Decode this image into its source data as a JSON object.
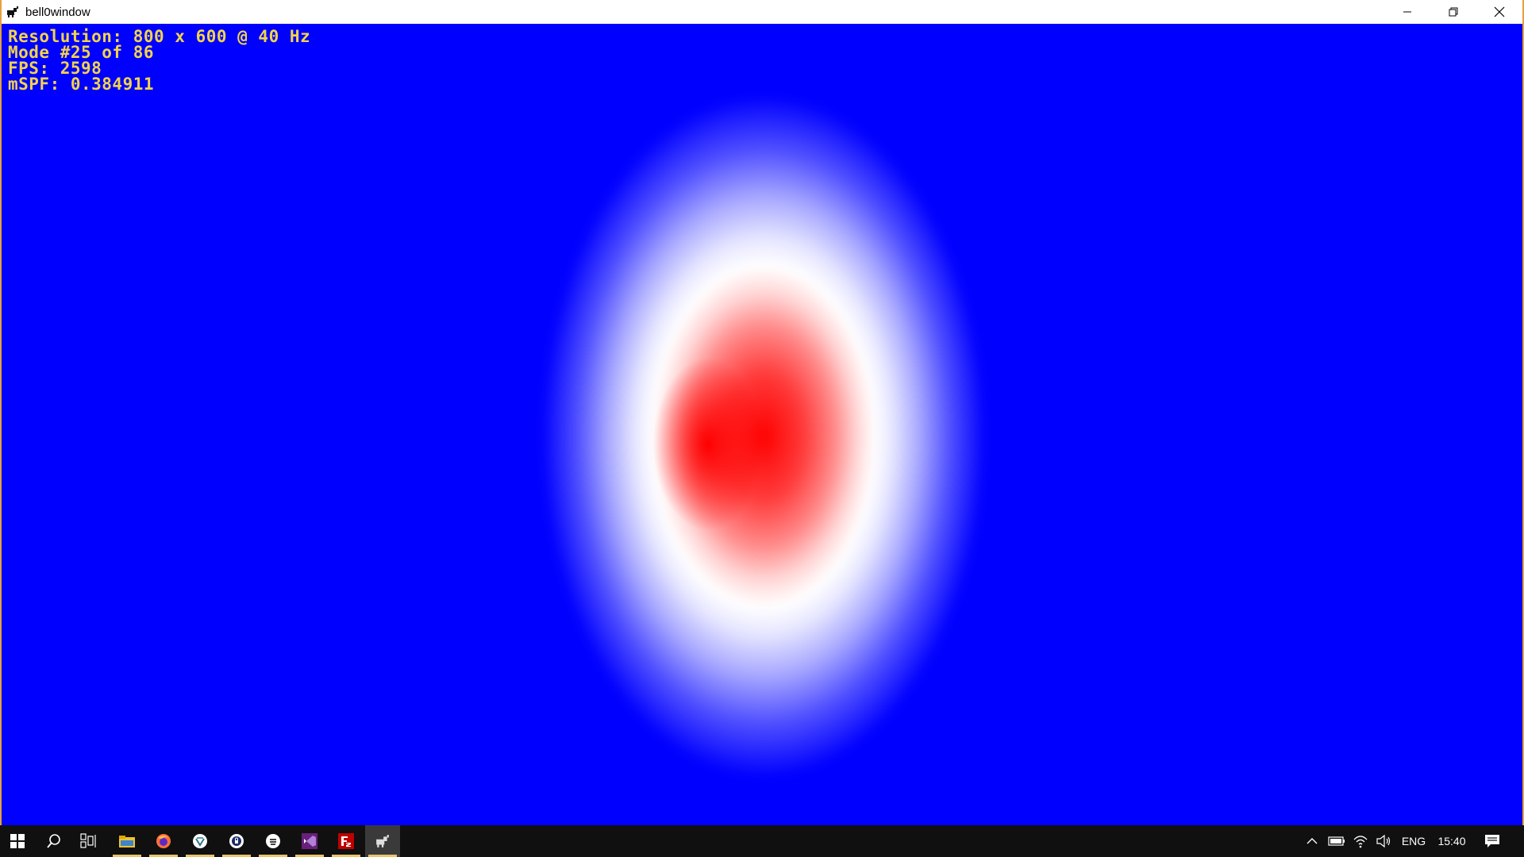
{
  "window": {
    "title": "bell0window"
  },
  "overlay": {
    "resolution": "Resolution: 800 x 600 @ 40 Hz",
    "mode": "Mode #25 of 86",
    "fps": "FPS: 2598",
    "mspf": "mSPF: 0.384911"
  },
  "taskbar": {
    "language": "ENG",
    "time": "15:40",
    "icons": [
      "windows-start-icon",
      "search-icon",
      "task-view-icon",
      "file-explorer-icon",
      "firefox-icon",
      "vpn-app-icon",
      "password-manager-icon",
      "media-app-icon",
      "visual-studio-icon",
      "filezilla-icon",
      "bell0window-app-icon"
    ]
  },
  "colors": {
    "background": "#0000ff",
    "overlay_text": "#f2d34a",
    "window_border": "#e6a23c",
    "taskbar": "#101010",
    "bell_center": "#ff0000"
  }
}
